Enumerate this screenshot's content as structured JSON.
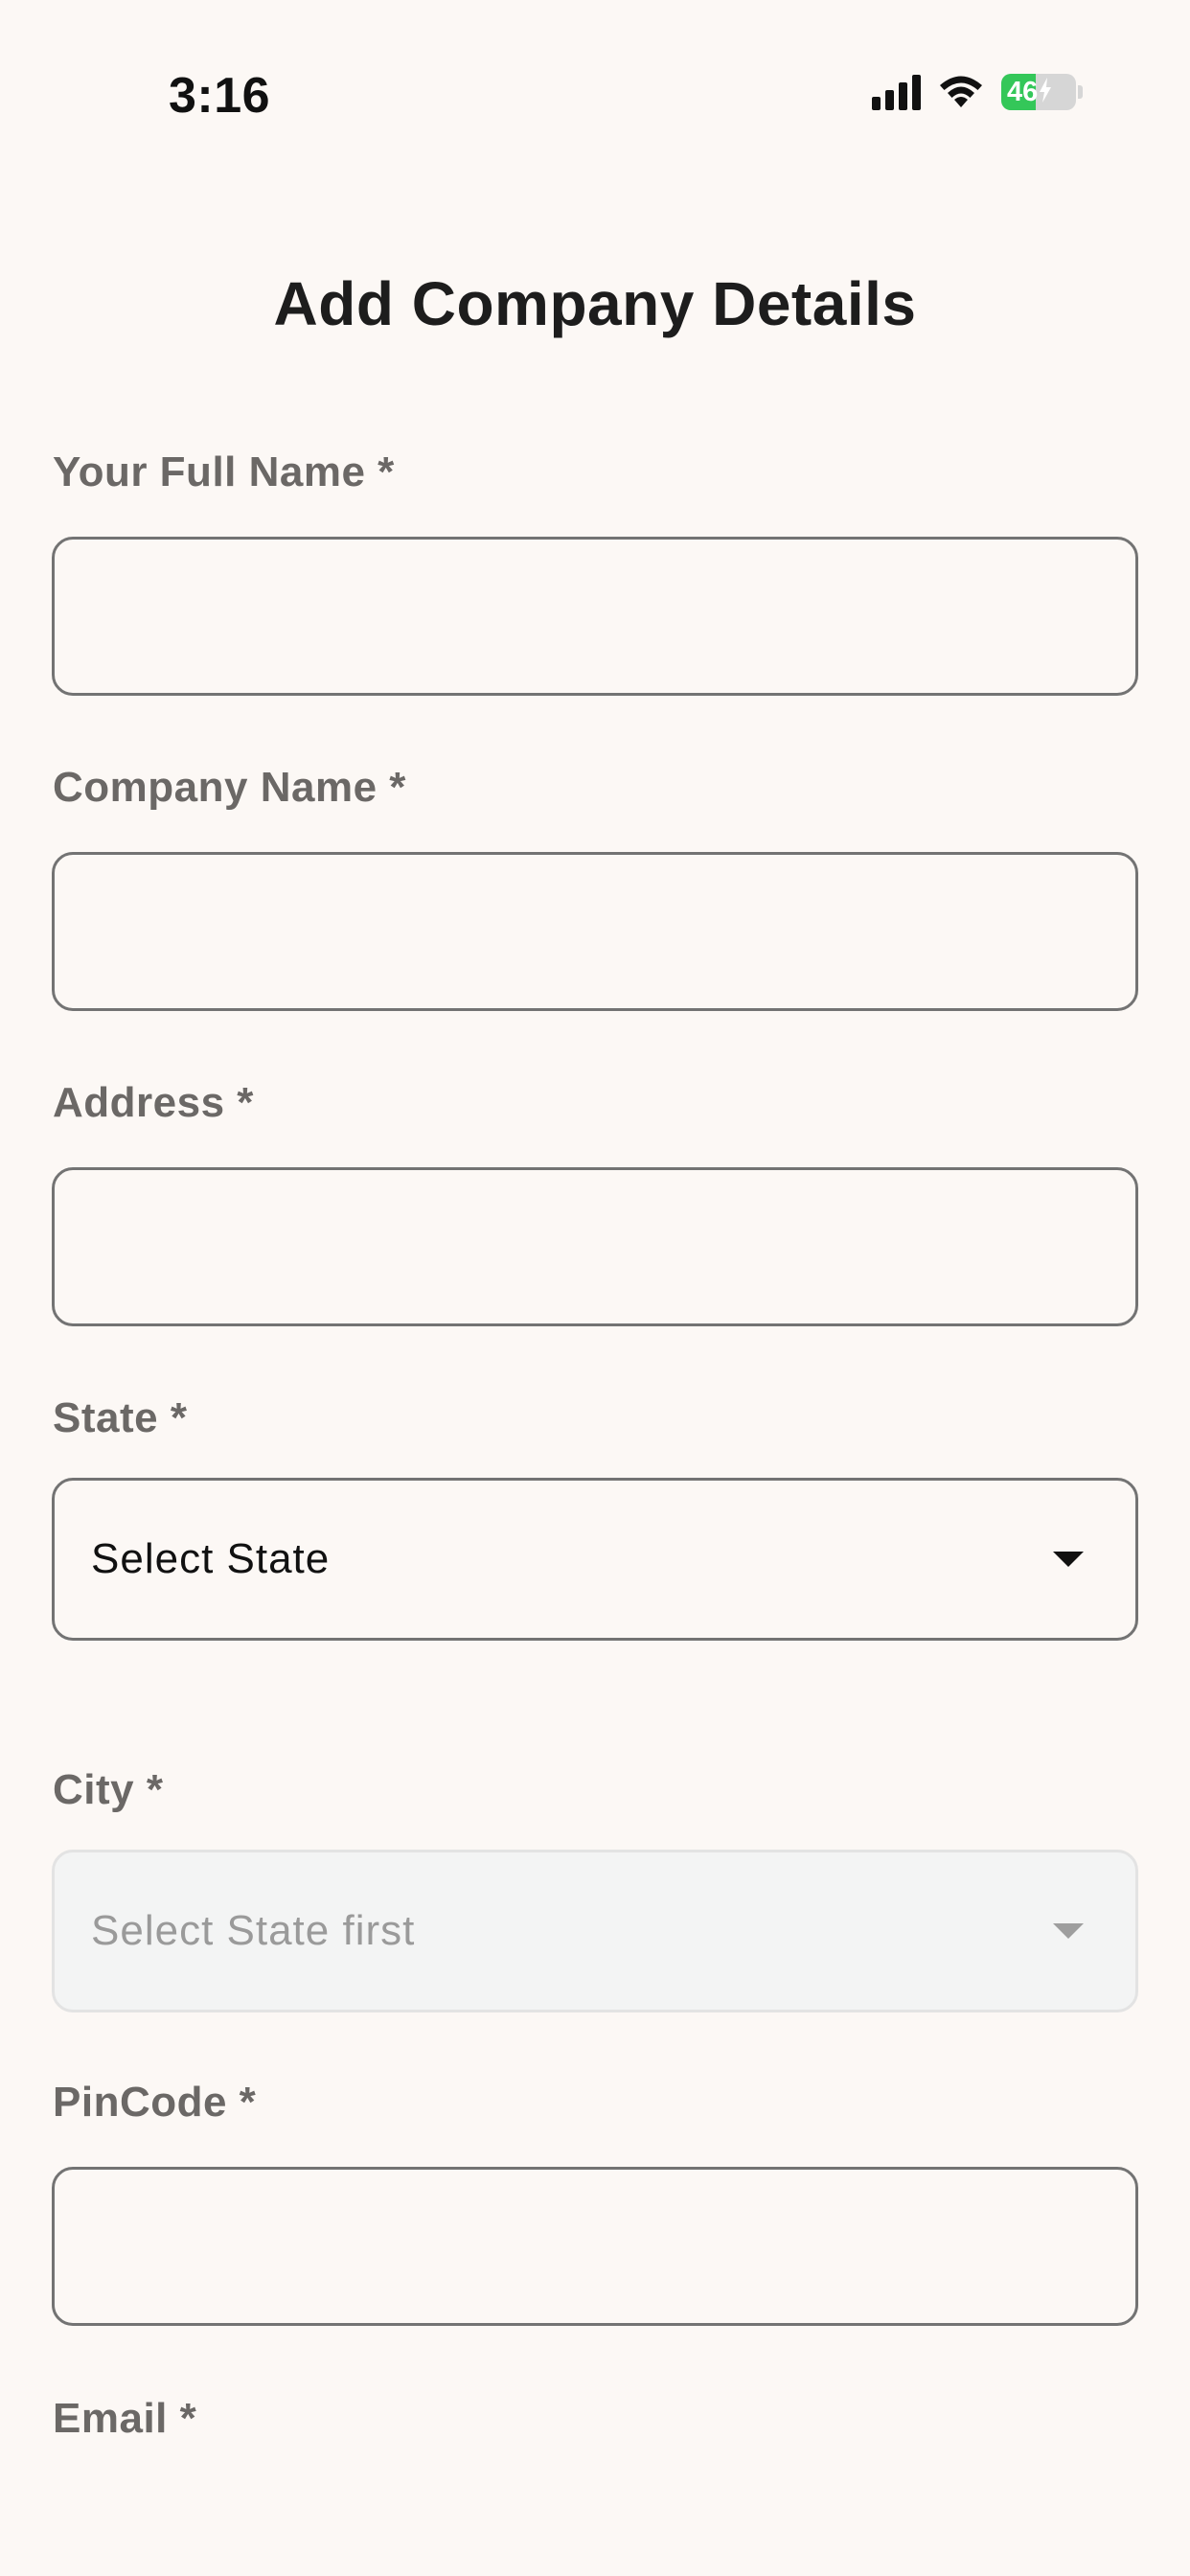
{
  "status_bar": {
    "time": "3:16",
    "battery_level": "46",
    "battery_fraction": 0.46,
    "battery_color": "#34c759",
    "icons": [
      "signal-icon",
      "wifi-icon",
      "battery-icon",
      "charging-bolt-icon"
    ]
  },
  "page": {
    "title": "Add Company Details"
  },
  "form": {
    "full_name": {
      "label": "Your Full Name *",
      "value": "",
      "placeholder": ""
    },
    "company_name": {
      "label": "Company Name *",
      "value": "",
      "placeholder": ""
    },
    "address": {
      "label": "Address *",
      "value": "",
      "placeholder": ""
    },
    "state": {
      "label": "State *",
      "selected": "Select State",
      "caret_icon": "caret-down-icon"
    },
    "city": {
      "label": "City *",
      "selected": "Select State first",
      "disabled": true,
      "caret_icon": "caret-down-icon"
    },
    "pincode": {
      "label": "PinCode *",
      "value": "",
      "placeholder": ""
    },
    "email": {
      "label": "Email *"
    }
  },
  "colors": {
    "background": "#fcf8f5",
    "label": "#6b6866",
    "border": "#737373",
    "disabled_bg": "#f3f4f4"
  }
}
